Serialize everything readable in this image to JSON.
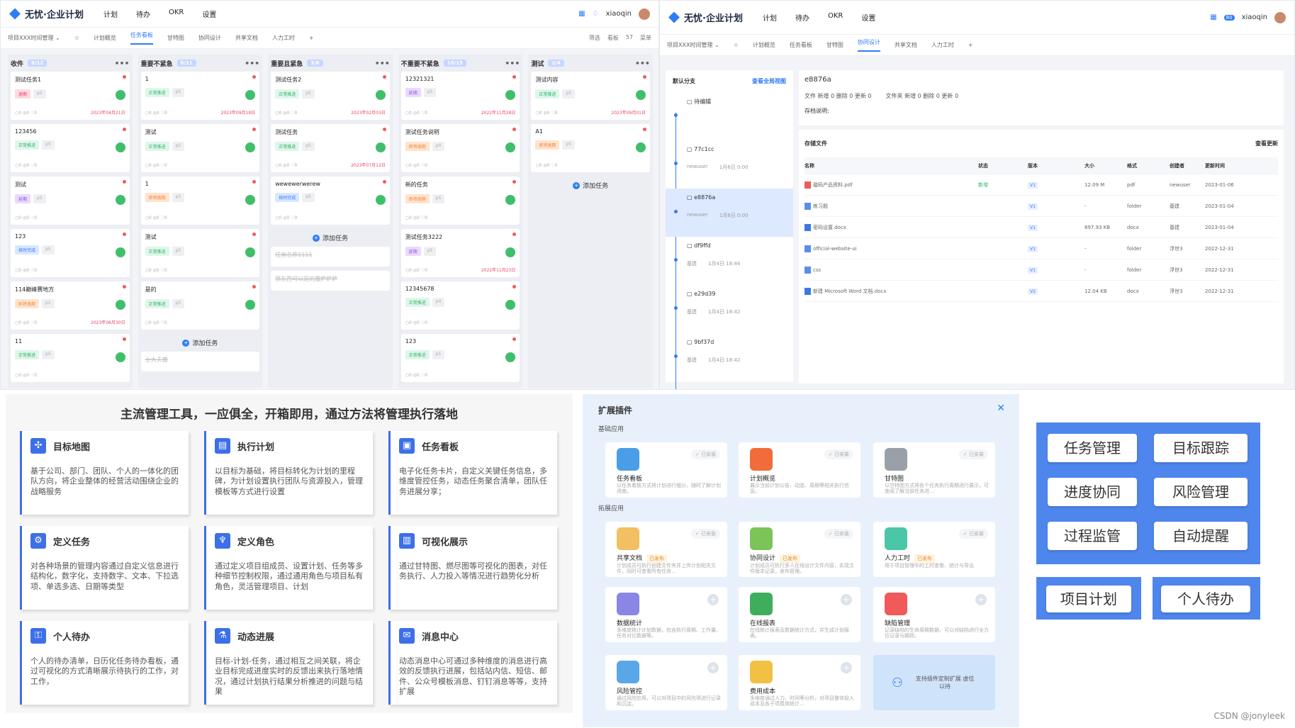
{
  "kanban": {
    "logo": "无忧·企业计划",
    "nav": [
      "计划",
      "待办",
      "OKR",
      "设置"
    ],
    "user": "xiaoqin",
    "project": "项目XXX时间管理",
    "tabs": [
      "计划概览",
      "任务看板",
      "甘特图",
      "协同设计",
      "共享文档",
      "人力工时"
    ],
    "active_tab": "任务看板",
    "tools": [
      "筛选",
      "看板",
      "57",
      "菜单"
    ],
    "columns": [
      {
        "title": "收件",
        "count": "8/12",
        "cards": [
          {
            "t": "测试任务1",
            "tags": [
              "逾期",
              "p2"
            ],
            "date": "2023年04月21日"
          },
          {
            "t": "123456",
            "tags": [
              "正常推进",
              "p5"
            ],
            "date": ""
          },
          {
            "t": "测试",
            "tags": [
              "延期",
              "p5"
            ],
            "date": ""
          },
          {
            "t": "123",
            "tags": [
              "按时完成",
              "p5"
            ],
            "date": ""
          },
          {
            "t": "114巅峰赛地方",
            "tags": [
              "即将逾期",
              "p1"
            ],
            "date": "2023年06月30日"
          },
          {
            "t": "11",
            "tags": [
              "正常推进",
              "p5"
            ],
            "date": ""
          }
        ]
      },
      {
        "title": "重要不紧急",
        "count": "6/11",
        "cards": [
          {
            "t": "1",
            "tags": [
              "正常推进",
              "p5"
            ],
            "date": "2023年09月18日"
          },
          {
            "t": "测试",
            "tags": [
              "正常推进",
              "p5"
            ],
            "date": ""
          },
          {
            "t": "1",
            "tags": [
              "即将逾期",
              "p5"
            ],
            "date": ""
          },
          {
            "t": "测试",
            "tags": [
              "正常推进",
              "p5"
            ],
            "date": ""
          },
          {
            "t": "是的",
            "tags": [
              "正常推进",
              "p5"
            ],
            "date": ""
          }
        ],
        "add": "添加任务",
        "done": "士大夫撒"
      },
      {
        "title": "重要且紧急",
        "count": "3/6",
        "cards": [
          {
            "t": "测试任务2",
            "tags": [
              "正常推进",
              "p5"
            ],
            "date": "2023年02月03日"
          },
          {
            "t": "测试任务",
            "tags": [
              "正常推进",
              "p5"
            ],
            "date": "2023年07月12日"
          },
          {
            "t": "wewewerwerew",
            "tags": [
              "按时完成",
              "p5"
            ],
            "date": ""
          }
        ],
        "add": "添加任务",
        "done1": "任务名称1111",
        "done2": "那东西可以是的撒萨萨萨"
      },
      {
        "title": "不重要不紧急",
        "count": "10/15",
        "cards": [
          {
            "t": "12321321",
            "tags": [
              "延期",
              "p5"
            ],
            "date": "2022年11月28日"
          },
          {
            "t": "测试任务说明",
            "tags": [
              "即将逾期",
              "p0"
            ],
            "date": ""
          },
          {
            "t": "新的任务",
            "tags": [
              "即将逾期",
              "p5"
            ],
            "date": ""
          },
          {
            "t": "测试任务3222",
            "tags": [
              "延期",
              "p5"
            ],
            "date": "2022年11月23日"
          },
          {
            "t": "12345678",
            "tags": [
              "正常推进",
              "p0"
            ],
            "date": ""
          },
          {
            "t": "123",
            "tags": [
              "正常推进",
              "p1"
            ],
            "date": ""
          }
        ]
      },
      {
        "title": "测试",
        "count": "2/4",
        "cards": [
          {
            "t": "测试内容",
            "tags": [
              "正常推进",
              "p5"
            ],
            "date": "2023年09月01日"
          },
          {
            "t": "A1",
            "tags": [
              "即将逾期",
              "p5"
            ],
            "date": ""
          }
        ],
        "add": "添加任务"
      }
    ]
  },
  "files": {
    "logo": "无忧·企业计划",
    "nav": [
      "计划",
      "待办",
      "OKR",
      "设置"
    ],
    "user": "xiaoqin",
    "badge": "80",
    "project": "项目XXX时间管理",
    "tabs": [
      "计划概览",
      "任务看板",
      "甘特图",
      "协同设计",
      "共享文档",
      "人力工时"
    ],
    "active_tab": "协同设计",
    "branch": "默认分支",
    "branch_link": "查看全局视图",
    "versions": [
      {
        "id": "待编辑",
        "user": "",
        "time": ""
      },
      {
        "id": "77c1cc",
        "user": "newuser",
        "time": "1月6日 0:00"
      },
      {
        "id": "e8876a",
        "user": "newuser",
        "time": "1月6日 0:00"
      },
      {
        "id": "df9ffd",
        "user": "基建",
        "time": "1月4日 18:44"
      },
      {
        "id": "e29d39",
        "user": "基建",
        "time": "1月4日 18:42"
      },
      {
        "id": "9bf37d",
        "user": "基建",
        "time": "1月4日 18:42"
      }
    ],
    "commit": "e8876a",
    "file_stat": "文件  新增 0  删除 0  更新 0",
    "folder_stat": "文件夹  新增 0  删除 0  更新 0",
    "desc_label": "存档说明:",
    "store_title": "存储文件",
    "view_update": "查看更新",
    "headers": [
      "名称",
      "状态",
      "版本",
      "大小",
      "格式",
      "创建者",
      "更新时间"
    ],
    "rows": [
      [
        "璇码产品资料.pdf",
        "新增",
        "V1",
        "12.09 M",
        "pdf",
        "newuser",
        "2023-01-06"
      ],
      [
        "练习题",
        "",
        "V1",
        "-",
        "folder",
        "基建",
        "2023-01-04"
      ],
      [
        "密码设置.docx",
        "",
        "V1",
        "897.93 KB",
        "docx",
        "基建",
        "2023-01-04"
      ],
      [
        "official-website-ui",
        "",
        "V1",
        "-",
        "folder",
        "浮世3",
        "2022-12-31"
      ],
      [
        "css",
        "",
        "V1",
        "-",
        "folder",
        "浮世3",
        "2022-12-31"
      ],
      [
        "新建 Microsoft Word 文档.docx",
        "",
        "V2",
        "12.04 KB",
        "docx",
        "浮世3",
        "2022-12-31"
      ]
    ]
  },
  "features": {
    "title": "主流管理工具，一应俱全，开箱即用，通过方法将管理执行落地",
    "items": [
      {
        "h": "目标地图",
        "d": "基于公司、部门、团队、个人的一体化的团队方向，将企业整体的经营活动围绕企业的战略服务"
      },
      {
        "h": "执行计划",
        "d": "以目标为基础，将目标转化为计划的里程碑，为计划设置执行团队与资源投入，管理模板等方式进行设置"
      },
      {
        "h": "任务看板",
        "d": "电子化任务卡片，自定义关键任务信息，多维度管控任务，动态任务聚合清单，团队任务进展分享；"
      },
      {
        "h": "定义任务",
        "d": "对各种场景的管理内容通过自定义信息进行结构化，数字化，支持数字、文本、下拉选项、单选多选、日期等类型"
      },
      {
        "h": "定义角色",
        "d": "通过定义项目组成员、设置计划、任务等多种细节控制权限，通过通用角色与项目私有角色，灵活管理项目、计划"
      },
      {
        "h": "可视化展示",
        "d": "通过甘特图、燃尽图等可视化的图表，对任务执行、人力投入等情况进行趋势化分析"
      },
      {
        "h": "个人待办",
        "d": "个人的待办清单，日历化任务待办看板，通过可视化的方式清晰展示待执行的工作，对工作，"
      },
      {
        "h": "动态进展",
        "d": "目标-计划-任务，通过相互之间关联，将企业目标完成进度实时的反馈出来执行落地情况，通过计划执行结果分析推进的问题与结果"
      },
      {
        "h": "消息中心",
        "d": "动态消息中心可通过多种维度的消息进行高效的反馈执行进展，包括站内信、短信、邮件、公众号模板消息、钉钉消息等等，支持扩展"
      }
    ]
  },
  "plugins": {
    "title": "扩展插件",
    "basic": "基础应用",
    "ext": "拓展应用",
    "installed": "已安装",
    "published": "已发布",
    "items": [
      {
        "n": "任务看板",
        "d": "以任务看板方式将计划进行细分，随时了解计划进度。",
        "s": "installed",
        "c": "#4a9ee8"
      },
      {
        "n": "计划概览",
        "d": "展示当前计划公告、动态、周期等相关执行信息。",
        "s": "installed",
        "c": "#f26b3a"
      },
      {
        "n": "甘特图",
        "d": "以甘特图方式将各个任务执行周期进行展示，可查阅了解当前任务进...",
        "s": "installed",
        "c": "#9aa0a8"
      },
      {
        "n": "共享文档",
        "d": "计划成员可执行创建文件夹并上传计划相关文件，同时可查看所有任务...",
        "s": "installed",
        "b": true,
        "c": "#f2c063"
      },
      {
        "n": "协同设计",
        "d": "计划成员可执行多人在线设计文件内容，实现文件版本记录，发布管理。",
        "s": "installed",
        "b": true,
        "c": "#7cc35a"
      },
      {
        "n": "人力工时",
        "d": "用于项目管理中的工时查看、统计与导出",
        "s": "installed",
        "b": true,
        "c": "#4bc7a7"
      },
      {
        "n": "数据统计",
        "d": "多维度统计计划数据，包含执行周期、工作量、任务对比数据等。",
        "s": "add",
        "c": "#8a86e6"
      },
      {
        "n": "在线报表",
        "d": "在线统计报表及数据统计方式，并生成计划报表。",
        "s": "add",
        "c": "#3fae5c"
      },
      {
        "n": "缺陷管理",
        "d": "记录缺陷的生命周期数据，可以对缺陷进行全方位记录与跟踪。",
        "s": "add",
        "c": "#f05a5a"
      },
      {
        "n": "风险管控",
        "d": "通过风险应用，可以对项目中的风险项进行记录和沉淀。",
        "s": "add",
        "c": "#5aa7e8"
      },
      {
        "n": "费用成本",
        "d": "多维度通过人力、时间等分析，对项目整体投入成本及各子项费用统计...",
        "s": "add",
        "c": "#f2c042"
      }
    ],
    "custom": "支持插件定制扩展 虚位以待"
  },
  "buttons": {
    "b1": "任务管理",
    "b2": "目标跟踪",
    "b3": "进度协同",
    "b4": "风险管理",
    "b5": "过程监管",
    "b6": "自动提醒",
    "b7": "项目计划",
    "b8": "个人待办"
  },
  "watermark": "CSDN @jonyleek"
}
